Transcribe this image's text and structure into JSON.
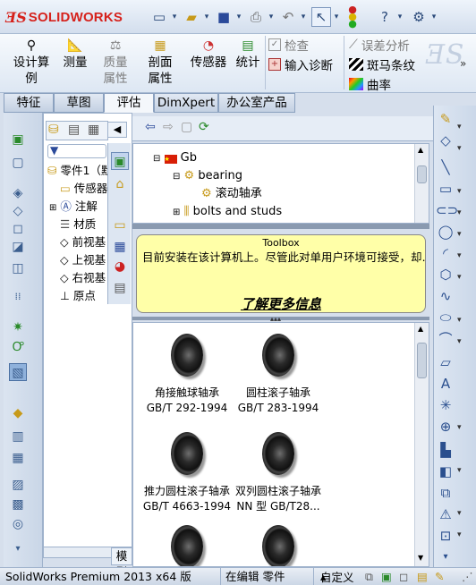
{
  "app": {
    "brand": "SOLIDWORKS",
    "brand_color": "#d6221c"
  },
  "quick_toolbar": {
    "icons": [
      "new-icon",
      "open-icon",
      "save-icon",
      "print-icon",
      "undo-icon",
      "select-icon",
      "traffic-light-icon",
      "help-icon",
      "options-icon"
    ]
  },
  "ribbon": {
    "buttons": [
      {
        "label": "设计算例"
      },
      {
        "label": "测量"
      },
      {
        "label": "质量属性"
      },
      {
        "label": "剖面属性"
      },
      {
        "label": "传感器"
      },
      {
        "label": "统计"
      }
    ],
    "check_label": "检查",
    "input_diag_label": "输入诊断",
    "deviation_label": "误差分析",
    "zebra_label": "斑马条纹",
    "curvature_label": "曲率"
  },
  "tabs": [
    {
      "label": "特征"
    },
    {
      "label": "草图"
    },
    {
      "label": "评估",
      "active": true
    },
    {
      "label": "DimXpert"
    },
    {
      "label": "办公室产品"
    }
  ],
  "feature_tree": {
    "part_label": "零件1（默",
    "items": [
      "传感器",
      "注解",
      "材质",
      "前视基",
      "上视基",
      "右视基",
      "原点"
    ]
  },
  "design_library": {
    "items": [
      {
        "label": "Gb",
        "level": 0
      },
      {
        "label": "bearing",
        "level": 1
      },
      {
        "label": "滚动轴承",
        "level": 2
      },
      {
        "label": "bolts and studs",
        "level": 1
      }
    ]
  },
  "toolbox_tip": {
    "title": "Toolbox",
    "message": "目前安装在该计算机上。尽管此对单用户环境可接受，却…",
    "link": "了解更多信息",
    "bg_color": "#ffffa8"
  },
  "gallery": {
    "items": [
      {
        "line1": "角接触球轴承",
        "line2": "GB/T 292-1994"
      },
      {
        "line1": "圆柱滚子轴承",
        "line2": "GB/T 283-1994"
      },
      {
        "line1": "推力圆柱滚子轴承",
        "line2": "GB/T 4663-1994"
      },
      {
        "line1": "双列圆柱滚子轴承",
        "line2": "NN 型 GB/T28..."
      },
      {
        "line1": "",
        "line2": ""
      },
      {
        "line1": "",
        "line2": ""
      }
    ]
  },
  "bottom_tab": "模型",
  "status": {
    "product": "SolidWorks Premium 2013 x64 版",
    "editing": "在编辑 零件",
    "custom": "自定义"
  }
}
